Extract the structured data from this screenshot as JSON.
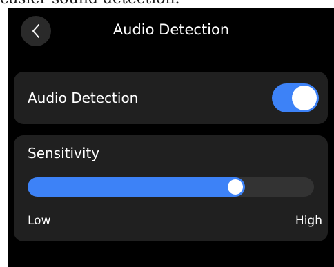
{
  "caption": "easier sound detection.",
  "header": {
    "title": "Audio Detection",
    "back_icon": "chevron-left-icon"
  },
  "audio_detection": {
    "label": "Audio Detection",
    "enabled": true
  },
  "sensitivity": {
    "label": "Sensitivity",
    "value_fraction": 0.76,
    "low_label": "Low",
    "high_label": "High"
  },
  "colors": {
    "accent": "#3d82f7",
    "background": "#000000",
    "card": "#202020",
    "track": "#333333",
    "text": "#ffffff"
  }
}
